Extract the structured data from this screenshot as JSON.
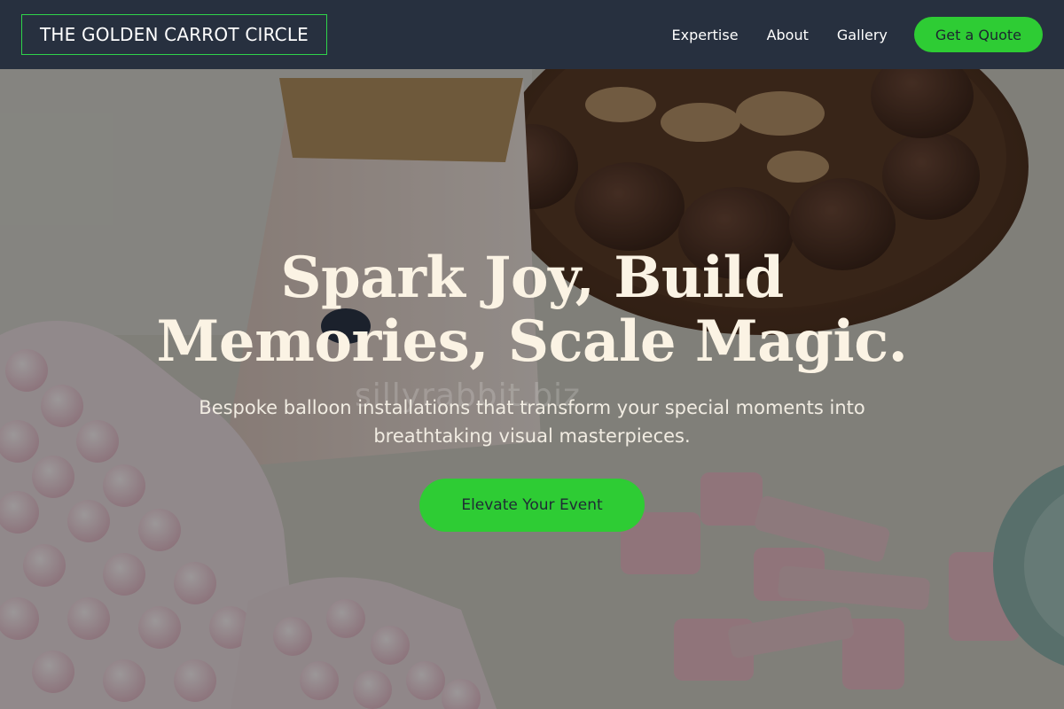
{
  "brand": {
    "name": "THE GOLDEN CARROT CIRCLE"
  },
  "nav": {
    "links": [
      "Expertise",
      "About",
      "Gallery"
    ],
    "quote_button": "Get a Quote"
  },
  "hero": {
    "headline_line1": "Spark Joy, Build",
    "headline_line2": "Memories, Scale Magic.",
    "subtitle_line1": "Bespoke balloon installations that transform your special moments into",
    "subtitle_line2": "breathtaking visual masterpieces.",
    "cta": "Elevate Your Event",
    "watermark": "sillyrabbit.biz"
  },
  "colors": {
    "header_bg": "#27303f",
    "accent_green": "#2ecc34",
    "headline": "#fbf3e4"
  }
}
